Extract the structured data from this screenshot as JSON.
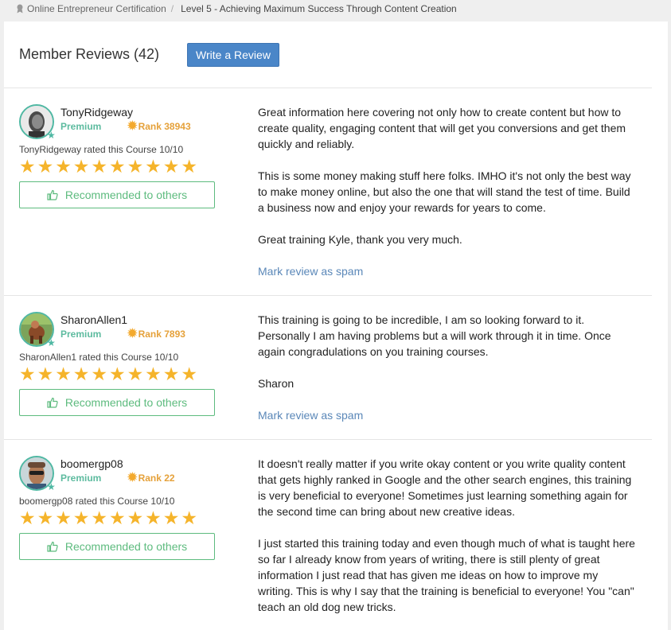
{
  "breadcrumb": {
    "items": [
      "Online Entrepreneur Certification",
      "Level 5 - Achieving Maximum Success Through Content Creation"
    ]
  },
  "header": {
    "title": "Member Reviews (42)",
    "write_button": "Write a Review"
  },
  "reviews": [
    {
      "username": "TonyRidgeway",
      "membership": "Premium",
      "rank": "Rank 38943",
      "rated_text": "TonyRidgeway rated this Course 10/10",
      "rating": 10,
      "recommend_label": "Recommended to others",
      "paragraphs": [
        "Great information here covering not only how to create content but how to create quality, engaging content that will get you conversions and get them quickly and reliably.",
        "This is some money making stuff here folks. IMHO it's not only the best way to make money online, but also the one that will stand the test of time. Build a business now and enjoy your rewards for years to come.",
        "Great training Kyle, thank you very much."
      ],
      "spam_label": "Mark review as spam"
    },
    {
      "username": "SharonAllen1",
      "membership": "Premium",
      "rank": "Rank 7893",
      "rated_text": "SharonAllen1 rated this Course 10/10",
      "rating": 10,
      "recommend_label": "Recommended to others",
      "paragraphs": [
        "This training is going to be incredible, I am so looking forward to it. Personally I am having problems but a will work through it in time. Once again congradulations on you training courses.",
        "Sharon"
      ],
      "spam_label": "Mark review as spam"
    },
    {
      "username": "boomergp08",
      "membership": "Premium",
      "rank": "Rank 22",
      "rated_text": "boomergp08 rated this Course 10/10",
      "rating": 10,
      "recommend_label": "Recommended to others",
      "paragraphs": [
        "It doesn't really matter if you write okay content or you write quality content that gets highly ranked in Google and the other search engines, this training is very beneficial to everyone! Sometimes just learning something again for the second time can bring about new creative ideas.",
        "I just started this training today and even though much of what is taught here so far I already know from years of writing, there is still plenty of great information I just read that has given me ideas on how to improve my writing. This is why I say that the training is beneficial to everyone! You \"can\" teach an old dog new tricks."
      ],
      "spam_label": ""
    }
  ],
  "colors": {
    "accent_blue": "#4a86c8",
    "premium_teal": "#5dbb9f",
    "rank_orange": "#e5a13a",
    "star_yellow": "#f5b42b",
    "recommend_green": "#5dbb7e",
    "link_blue": "#5a87b8"
  },
  "icons": {
    "breadcrumb": "award-icon",
    "recommend": "thumbs-up-icon",
    "rank": "sun-burst-icon",
    "rating": "star-icon"
  }
}
